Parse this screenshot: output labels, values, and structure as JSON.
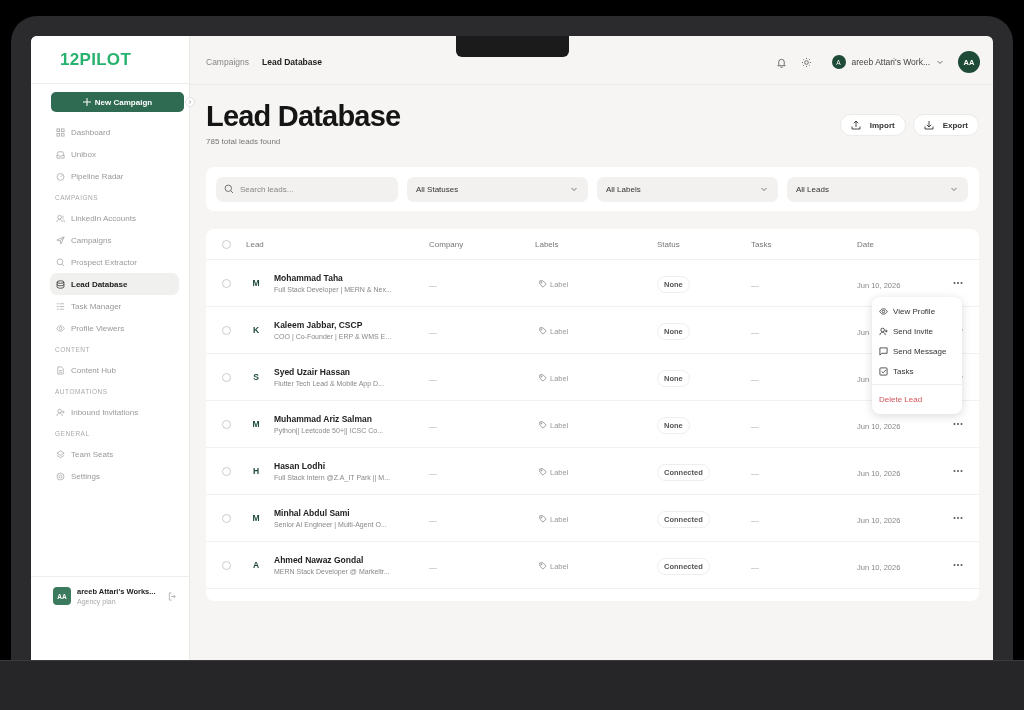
{
  "sidebar": {
    "logo": "12PILOT",
    "new_button": "New Campaign",
    "sections": [
      {
        "items": [
          {
            "label": "Dashboard",
            "selected": false
          },
          {
            "label": "Unibox",
            "selected": false
          },
          {
            "label": "Pipeline Radar",
            "selected": false
          }
        ]
      },
      {
        "heading": "CAMPAIGNS",
        "items": [
          {
            "label": "LinkedIn Accounts",
            "selected": false
          },
          {
            "label": "Campaigns",
            "selected": false
          },
          {
            "label": "Prospect Extractor",
            "selected": false
          },
          {
            "label": "Lead Database",
            "selected": true
          },
          {
            "label": "Task Manager",
            "selected": false
          },
          {
            "label": "Profile Viewers",
            "selected": false
          }
        ]
      },
      {
        "heading": "CONTENT",
        "items": [
          {
            "label": "Content Hub",
            "selected": false
          }
        ]
      },
      {
        "heading": "AUTOMATIONS",
        "items": [
          {
            "label": "Inbound Invitations",
            "selected": false
          }
        ]
      },
      {
        "heading": "GENERAL",
        "items": [
          {
            "label": "Team Seats",
            "selected": false
          },
          {
            "label": "Settings",
            "selected": false
          }
        ]
      }
    ],
    "account": {
      "initials": "AA",
      "name": "areeb Attari's Works...",
      "plan": "Agency plan"
    }
  },
  "topbar": {
    "breadcrumbs": [
      {
        "label": "Campaigns",
        "current": false
      },
      {
        "label": "Lead Database",
        "current": true
      }
    ],
    "workspace": {
      "initial": "A",
      "name": "areeb Attari's Work..."
    },
    "avatar": "AA"
  },
  "header": {
    "title": "Lead Database",
    "subtitle": "785 total leads found",
    "buttons": [
      {
        "label": "Import",
        "kind": "upload"
      },
      {
        "label": "Export",
        "kind": "download"
      }
    ]
  },
  "filters": {
    "search": {
      "placeholder": "Search leads..."
    },
    "dropdowns": [
      "All Statuses",
      "All Labels",
      "All Leads"
    ]
  },
  "table": {
    "select_all_checked": false,
    "columns": [
      "Lead",
      "Company",
      "Labels",
      "Status",
      "Tasks",
      "Date"
    ],
    "rows": [
      {
        "initial": "M",
        "name": "Mohammad Taha",
        "headline": "Full Stack Developer | MERN & Nex...",
        "company": "—",
        "label": "Label",
        "status": "None",
        "tasks": "—",
        "date": "Jun 10, 2026",
        "checked": false
      },
      {
        "initial": "K",
        "name": "Kaleem Jabbar, CSCP",
        "headline": "COO | Co-Founder | ERP & WMS E...",
        "company": "—",
        "label": "Label",
        "status": "None",
        "tasks": "—",
        "date": "Jun",
        "checked": false
      },
      {
        "initial": "S",
        "name": "Syed Uzair Hassan",
        "headline": "Flutter Tech Lead & Mobile App D...",
        "company": "—",
        "label": "Label",
        "status": "None",
        "tasks": "—",
        "date": "Jun",
        "checked": false
      },
      {
        "initial": "M",
        "name": "Muhammad Ariz Salman",
        "headline": "Python|| Leetcode 50+|| ICSC Co...",
        "company": "—",
        "label": "Label",
        "status": "None",
        "tasks": "—",
        "date": "Jun 10, 2026",
        "checked": false
      },
      {
        "initial": "H",
        "name": "Hasan Lodhi",
        "headline": "Full Stack Intern @Z.A_IT Park || M...",
        "company": "—",
        "label": "Label",
        "status": "Connected",
        "tasks": "—",
        "date": "Jun 10, 2026",
        "checked": false
      },
      {
        "initial": "M",
        "name": "Minhal Abdul Sami",
        "headline": "Senior AI Engineer | Multi-Agent O...",
        "company": "—",
        "label": "Label",
        "status": "Connected",
        "tasks": "—",
        "date": "Jun 10, 2026",
        "checked": false
      },
      {
        "initial": "A",
        "name": "Ahmed Nawaz Gondal",
        "headline": "MERN Stack Developer @ Markeltr...",
        "company": "—",
        "label": "Label",
        "status": "Connected",
        "tasks": "—",
        "date": "Jun 10, 2026",
        "checked": false
      }
    ],
    "menu": [
      {
        "label": "View Profile",
        "kind": "eye"
      },
      {
        "label": "Send Invite",
        "kind": "user-plus"
      },
      {
        "label": "Send Message",
        "kind": "message"
      },
      {
        "label": "Tasks",
        "kind": "check"
      },
      {
        "label": "Delete Lead",
        "kind": "danger"
      }
    ]
  }
}
